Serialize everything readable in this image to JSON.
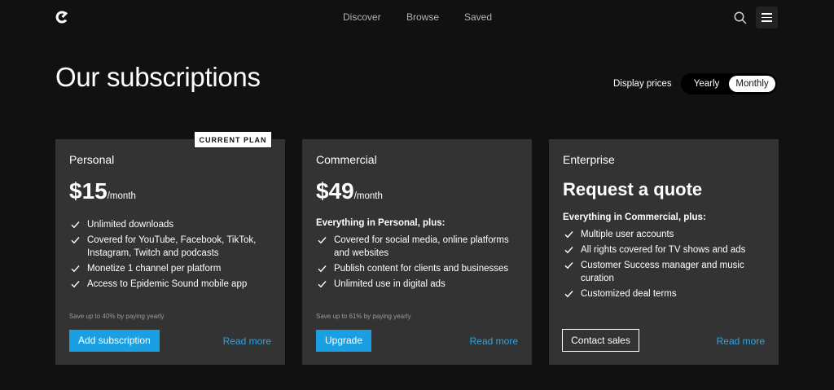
{
  "header": {
    "nav": [
      "Discover",
      "Browse",
      "Saved"
    ]
  },
  "title": "Our subscriptions",
  "pricing_toggle": {
    "label": "Display prices",
    "options": [
      "Yearly",
      "Monthly"
    ],
    "selected": "Monthly"
  },
  "plans": [
    {
      "name": "Personal",
      "badge": "CURRENT PLAN",
      "price": "$15",
      "period": "/month",
      "features": [
        "Unlimited downloads",
        "Covered for YouTube, Facebook, TikTok, Instagram, Twitch and podcasts",
        "Monetize 1 channel per platform",
        "Access to Epidemic Sound mobile app"
      ],
      "save_note": "Save up to 40% by paying yearly",
      "cta": "Add subscription",
      "read_more": "Read more"
    },
    {
      "name": "Commercial",
      "price": "$49",
      "period": "/month",
      "intro": "Everything in Personal, plus:",
      "features": [
        "Covered for social media, online platforms and websites",
        "Publish content for clients and businesses",
        "Unlimited use in digital ads"
      ],
      "save_note": "Save up to 61% by paying yearly",
      "cta": "Upgrade",
      "read_more": "Read more"
    },
    {
      "name": "Enterprise",
      "quote": "Request a quote",
      "intro": "Everything in Commercial, plus:",
      "features": [
        "Multiple user accounts",
        "All rights covered for TV shows and ads",
        "Customer Success manager and music curation",
        "Customized deal terms"
      ],
      "cta": "Contact sales",
      "read_more": "Read more"
    }
  ],
  "colors": {
    "background": "#121112",
    "card": "#333333",
    "accent": "#1aa0e2",
    "link": "#2aa6e6"
  },
  "icons": [
    "logo-icon",
    "search-icon",
    "menu-icon",
    "check-icon"
  ]
}
